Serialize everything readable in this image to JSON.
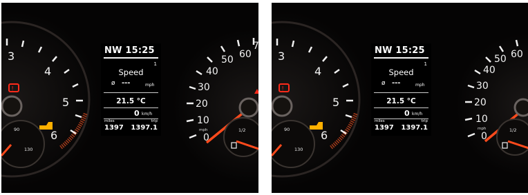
{
  "photos": [
    {
      "display": {
        "heading": "NW 15:25",
        "page_indicator": "1",
        "title": "Speed",
        "avg_symbol": "ø",
        "avg_value": "---",
        "avg_unit": "mph",
        "temperature": "21.5 °C",
        "speed_value": "0",
        "speed_unit": "km/h",
        "odometer_label": "miles",
        "trip_label": "trip",
        "odometer_value": "1397",
        "trip_value": "1397.1"
      },
      "tachometer": {
        "labels": [
          "3",
          "4",
          "5",
          "6"
        ],
        "small_gauge_labels": [
          "90",
          "130"
        ]
      },
      "speedometer": {
        "labels": [
          "10",
          "20",
          "30",
          "40",
          "50",
          "60",
          "7"
        ],
        "unit": "mph",
        "small_gauge_label": "1/2"
      },
      "colors": {
        "display_bg": "#000000",
        "needle": "#ff4a1c",
        "warning": "#ff2a1a",
        "amber": "#ffb000"
      }
    },
    {
      "display": {
        "heading": "NW 15:25",
        "page_indicator": "1",
        "title": "Speed",
        "avg_symbol": "ø",
        "avg_value": "---",
        "avg_unit": "mph",
        "temperature": "21.5 °C",
        "speed_value": "0",
        "speed_unit": "km/h",
        "odometer_label": "miles",
        "trip_label": "trip",
        "odometer_value": "1397",
        "trip_value": "1397.1"
      },
      "tachometer": {
        "labels": [
          "3",
          "4",
          "5",
          "6"
        ],
        "small_gauge_labels": [
          "90",
          "130"
        ]
      },
      "speedometer": {
        "labels": [
          "10",
          "20",
          "30",
          "40",
          "50",
          "60"
        ],
        "unit": "mph",
        "small_gauge_label": "1/2"
      },
      "colors": {
        "display_bg": "#000000",
        "needle": "#ff4a1c",
        "warning": "#ff2a1a",
        "amber": "#ffb000"
      }
    }
  ]
}
